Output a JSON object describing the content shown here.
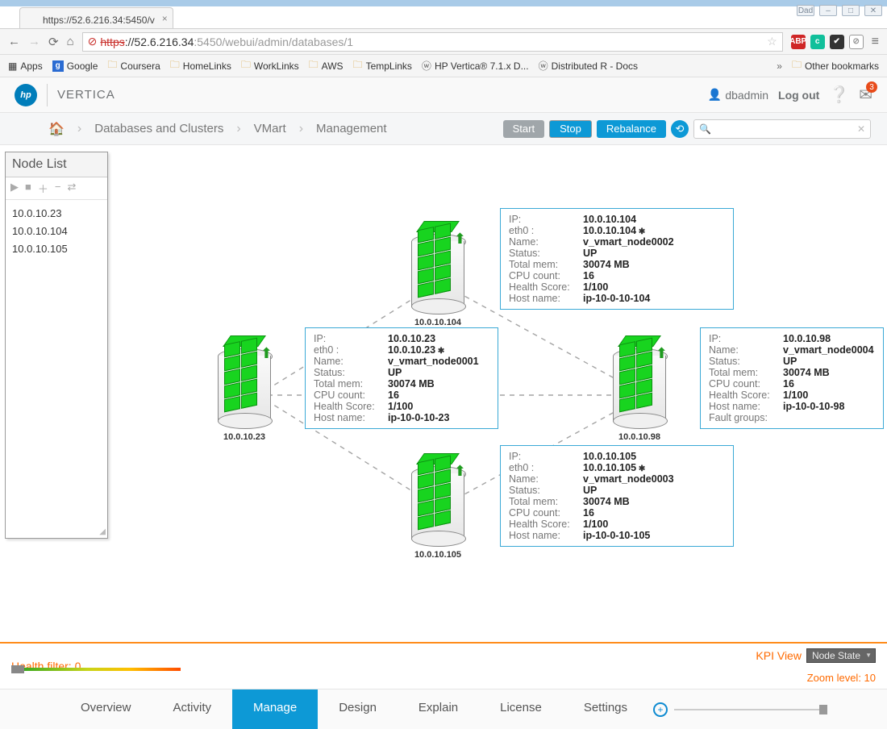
{
  "window": {
    "buttons": [
      "Dad",
      "–",
      "□",
      "✕"
    ]
  },
  "browser_tab": "https://52.6.216.34:5450/v",
  "url": {
    "scheme": "https",
    "host": "://52.6.216.34",
    "port": ":5450",
    "path": "/webui/admin/databases/1"
  },
  "bookmarks": {
    "apps": "Apps",
    "items": [
      "Google",
      "Coursera",
      "HomeLinks",
      "WorkLinks",
      "AWS",
      "TempLinks",
      "HP Vertica® 7.1.x D...",
      "Distributed R - Docs"
    ],
    "other": "Other bookmarks",
    "chev": "»"
  },
  "header": {
    "brand": "VERTICA",
    "user": "dbadmin",
    "logout": "Log out",
    "notif_badge": "3"
  },
  "breadcrumb": [
    "Databases and Clusters",
    "VMart",
    "Management"
  ],
  "actions": {
    "start": "Start",
    "stop": "Stop",
    "rebalance": "Rebalance"
  },
  "search_placeholder": "",
  "node_list": {
    "title": "Node List",
    "items": [
      "10.0.10.23",
      "10.0.10.104",
      "10.0.10.105"
    ]
  },
  "nodes": {
    "n1": {
      "ip": "10.0.10.23",
      "label": "10.0.10.23"
    },
    "n2": {
      "ip": "10.0.10.104",
      "label": "10.0.10.104"
    },
    "n3": {
      "ip": "10.0.10.105",
      "label": "10.0.10.105"
    },
    "n4": {
      "ip": "10.0.10.98",
      "label": "10.0.10.98"
    }
  },
  "cards": {
    "c1": {
      "ip": "10.0.10.23",
      "eth0": "10.0.10.23",
      "name": "v_vmart_node0001",
      "status": "UP",
      "mem": "30074 MB",
      "cpu": "16",
      "health": "1/100",
      "host": "ip-10-0-10-23"
    },
    "c2": {
      "ip": "10.0.10.104",
      "eth0": "10.0.10.104",
      "name": "v_vmart_node0002",
      "status": "UP",
      "mem": "30074 MB",
      "cpu": "16",
      "health": "1/100",
      "host": "ip-10-0-10-104"
    },
    "c3": {
      "ip": "10.0.10.105",
      "eth0": "10.0.10.105",
      "name": "v_vmart_node0003",
      "status": "UP",
      "mem": "30074 MB",
      "cpu": "16",
      "health": "1/100",
      "host": "ip-10-0-10-105"
    },
    "c4": {
      "ip": "10.0.10.98",
      "name": "v_vmart_node0004",
      "status": "UP",
      "mem": "30074 MB",
      "cpu": "16",
      "health": "1/100",
      "host": "ip-10-0-10-98",
      "fault": ""
    }
  },
  "labels": {
    "ip": "IP:",
    "eth0": "eth0 :",
    "name": "Name:",
    "status": "Status:",
    "mem": "Total mem:",
    "cpu": "CPU count:",
    "health": "Health Score:",
    "host": "Host name:",
    "fault": "Fault groups:"
  },
  "filters": {
    "health": "Health filter: 0",
    "kpi_label": "KPI View",
    "kpi_value": "Node State",
    "zoom": "Zoom level: 10"
  },
  "tabs": [
    "Overview",
    "Activity",
    "Manage",
    "Design",
    "Explain",
    "License",
    "Settings"
  ],
  "active_tab": "Manage"
}
